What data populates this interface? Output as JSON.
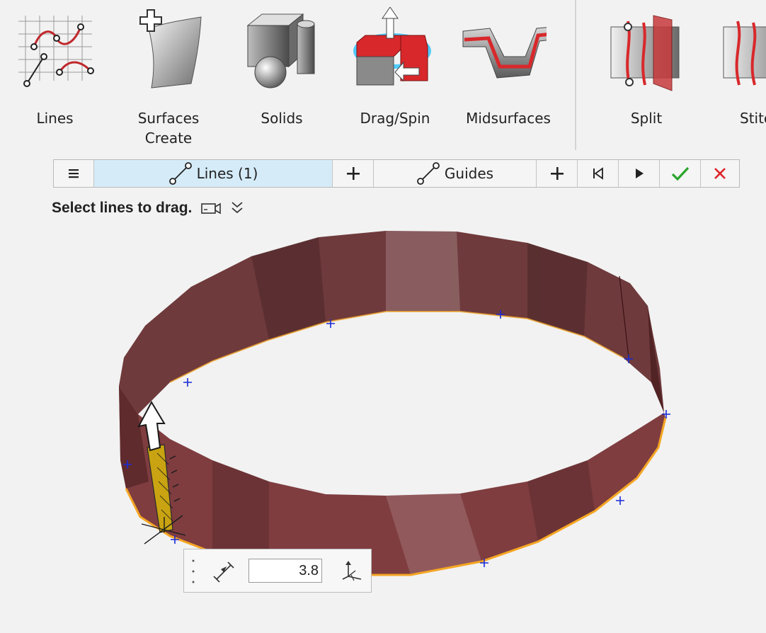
{
  "ribbon": {
    "tools": [
      {
        "label": "Lines",
        "icon": "lines-icon"
      },
      {
        "label": "Surfaces\nCreate",
        "icon": "surfaces-create-icon"
      },
      {
        "label": "Solids",
        "icon": "solids-icon"
      },
      {
        "label": "Drag/Spin",
        "icon": "drag-spin-icon"
      },
      {
        "label": "Midsurfaces",
        "icon": "midsurfaces-icon"
      },
      {
        "label": "Split",
        "icon": "split-icon"
      },
      {
        "label": "Stitc",
        "icon": "stitch-icon"
      }
    ]
  },
  "guidebar": {
    "menu_icon": "hamburger-menu-icon",
    "lines_label": "Lines (1)",
    "guides_label": "Guides",
    "add_icon": "plus-icon",
    "first_icon": "skip-back-icon",
    "play_icon": "play-icon",
    "apply_icon": "check-icon",
    "cancel_icon": "close-icon"
  },
  "prompt": {
    "text": "Select lines to drag.",
    "camera_icon": "camera-icon",
    "expand_icon": "double-chevron-down-icon"
  },
  "value_popup": {
    "value": "3.8",
    "distance_icon": "distance-icon",
    "axis_icon": "axis-icon"
  },
  "colors": {
    "surface": "#7a3b3d",
    "edge_highlight": "#f5a623",
    "active_tab": "#d5ecf8",
    "check": "#2aa52a",
    "cancel": "#e0242a",
    "node_mark": "#1a2bd6"
  }
}
